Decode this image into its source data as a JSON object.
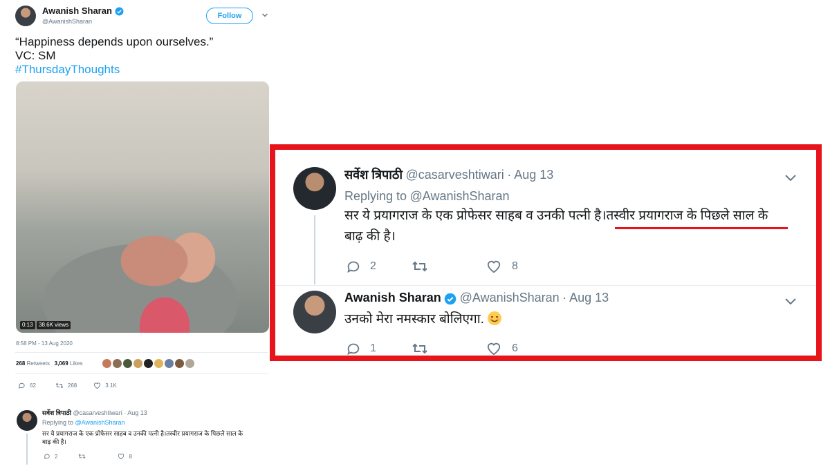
{
  "left_tweet": {
    "author_name": "Awanish Sharan",
    "author_handle": "@AwanishSharan",
    "follow_label": "Follow",
    "text_line1": "“Happiness depends upon ourselves.”",
    "text_line2": "VC: SM",
    "hashtag": "#ThursdayThoughts",
    "video_time": "0:13",
    "video_views": "38.6K views",
    "timestamp": "8:58 PM - 13 Aug 2020",
    "retweets_count": "268",
    "retweets_label": "Retweets",
    "likes_count": "3,069",
    "likes_label": "Likes",
    "reply_count": "62",
    "retweet_count": "268",
    "like_count": "3.1K"
  },
  "left_reply": {
    "author_name": "सर्वेश त्रिपाठी",
    "author_handle": "@casarveshtiwari",
    "date": "· Aug 13",
    "replying_to_prefix": "Replying to",
    "replying_to_handle": "@AwanishSharan",
    "text_line1": "सर ये प्रयागराज के एक प्रोफेसर साहब व उनकी पत्नी है।तस्वीर प्रयागराज के पिछले साल के",
    "text_line2": "बाढ़ की है।",
    "reply_count": "2",
    "like_count": "8"
  },
  "highlight": {
    "border_color": "#e8141b",
    "reply1": {
      "author_name": "सर्वेश त्रिपाठी",
      "author_handle": "@casarveshtiwari",
      "date": "· Aug 13",
      "replying_to_prefix": "Replying to",
      "replying_to_handle": "@AwanishSharan",
      "text_part1": "सर ये प्रयागराज के एक प्रोफेसर साहब व उनकी पत्नी है।",
      "text_part2": "तस्वीर प्रयागराज के पिछले साल के",
      "text_line2": "बाढ़ की है।",
      "reply_count": "2",
      "like_count": "8"
    },
    "reply2": {
      "author_name": "Awanish Sharan",
      "author_handle": "@AwanishSharan",
      "date": "· Aug 13",
      "text": "उनको मेरा नमस्कार बोलिएगा.",
      "reply_count": "1",
      "like_count": "6"
    }
  },
  "icons": {
    "verified": "verified-badge-icon",
    "reply": "reply-icon",
    "retweet": "retweet-icon",
    "like": "heart-icon",
    "chevron": "chevron-down-icon",
    "emoji": "smiling-face-emoji-icon"
  },
  "colors": {
    "link": "#1da1f2",
    "text": "#14171a",
    "muted": "#657786",
    "highlight": "#e8141b"
  }
}
